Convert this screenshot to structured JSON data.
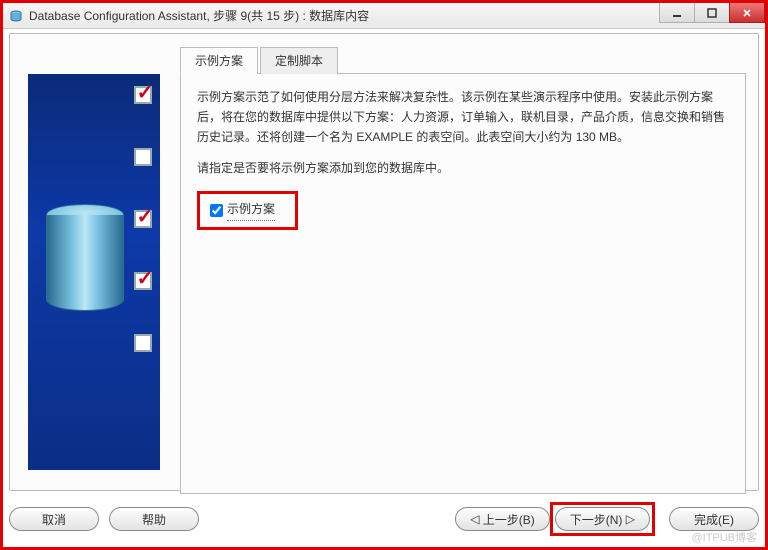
{
  "window": {
    "title": "Database Configuration Assistant, 步骤 9(共 15 步) : 数据库内容"
  },
  "sidebar": {
    "steps": [
      {
        "checked": true
      },
      {
        "checked": false
      },
      {
        "checked": true
      },
      {
        "checked": true
      },
      {
        "checked": false
      }
    ]
  },
  "tabs": {
    "sample": "示例方案",
    "custom": "定制脚本"
  },
  "body": {
    "paragraph": "示例方案示范了如何使用分层方法来解决复杂性。该示例在某些演示程序中使用。安装此示例方案后，将在您的数据库中提供以下方案：人力资源，订单输入，联机目录，产品介质，信息交换和销售历史记录。还将创建一个名为 EXAMPLE 的表空间。此表空间大小约为 130 MB。",
    "prompt": "请指定是否要将示例方案添加到您的数据库中。",
    "checkbox_label": "示例方案",
    "checkbox_checked": true
  },
  "footer": {
    "cancel": "取消",
    "help": "帮助",
    "back": "上一步(B)",
    "next": "下一步(N)",
    "finish": "完成(E)"
  },
  "watermark": "@ITPUB博客"
}
